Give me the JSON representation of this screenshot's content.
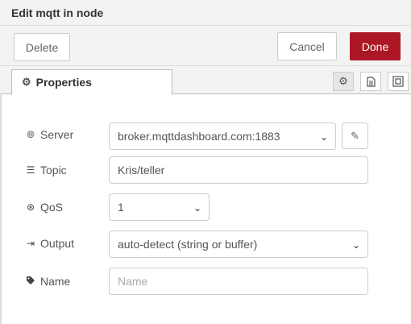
{
  "dialog": {
    "title": "Edit mqtt in node"
  },
  "toolbar": {
    "delete_label": "Delete",
    "cancel_label": "Cancel",
    "done_label": "Done"
  },
  "tabs": {
    "properties_label": "Properties",
    "icons": [
      "gear-icon",
      "description-icon",
      "appearance-icon"
    ]
  },
  "form": {
    "server": {
      "label": "Server",
      "value": "broker.mqttdashboard.com:1883"
    },
    "topic": {
      "label": "Topic",
      "value": "Kris/teller"
    },
    "qos": {
      "label": "QoS",
      "value": "1"
    },
    "output": {
      "label": "Output",
      "value": "auto-detect (string or buffer)"
    },
    "name": {
      "label": "Name",
      "value": "",
      "placeholder": "Name"
    }
  },
  "colors": {
    "done_button": "#ad1625",
    "toolbar_bg": "#f3f3f3"
  }
}
